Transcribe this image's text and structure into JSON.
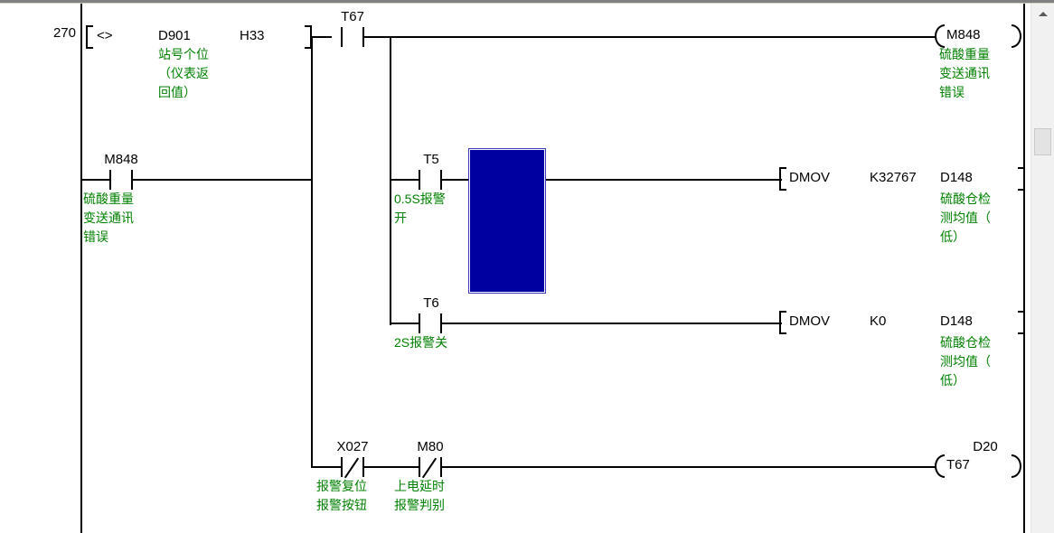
{
  "editor": {
    "step_number": "270",
    "colors": {
      "wire": "#000000",
      "comment": "#008000",
      "selection": "#0000a0",
      "scrollbar_track": "#f1f1f1"
    }
  },
  "scrollbar": {
    "up_arrow_icon": "triangle-up-icon",
    "thumb_name": "vertical-scroll-thumb"
  },
  "rungs": {
    "compare": {
      "operator": "<>",
      "operand1": "D901",
      "operand1_comment": "站号个位\n（仪表返\n回值）",
      "operand1_comment_l1": "站号个位",
      "operand1_comment_l2": "（仪表返",
      "operand1_comment_l3": "回值）",
      "operand2": "H33"
    },
    "t67_contact": {
      "device": "T67",
      "type": "normally-open"
    },
    "m848_coil": {
      "device": "M848",
      "comment_l1": "硫酸重量",
      "comment_l2": "变送通讯",
      "comment_l3": "错误"
    },
    "m848_contact": {
      "device": "M848",
      "type": "normally-open",
      "comment_l1": "硫酸重量",
      "comment_l2": "变送通讯",
      "comment_l3": "错误"
    },
    "t5_contact": {
      "device": "T5",
      "type": "normally-open",
      "comment_l1": "0.5S报警",
      "comment_l2": "开"
    },
    "dmov_k32767": {
      "instruction": "DMOV",
      "source": "K32767",
      "destination": "D148",
      "dest_comment_l1": "硫酸仓检",
      "dest_comment_l2": "测均值（",
      "dest_comment_l3": "低）"
    },
    "t6_contact": {
      "device": "T6",
      "type": "normally-open",
      "comment_l1": "2S报警关"
    },
    "dmov_k0": {
      "instruction": "DMOV",
      "source": "K0",
      "destination": "D148",
      "dest_comment_l1": "硫酸仓检",
      "dest_comment_l2": "测均值（",
      "dest_comment_l3": "低）"
    },
    "x027_contact": {
      "device": "X027",
      "type": "normally-closed",
      "comment_l1": "报警复位",
      "comment_l2": "报警按钮"
    },
    "m80_contact": {
      "device": "M80",
      "type": "normally-closed",
      "comment_l1": "上电延时",
      "comment_l2": "报警判别"
    },
    "t67_coil": {
      "device": "T67",
      "preset": "D20"
    }
  }
}
